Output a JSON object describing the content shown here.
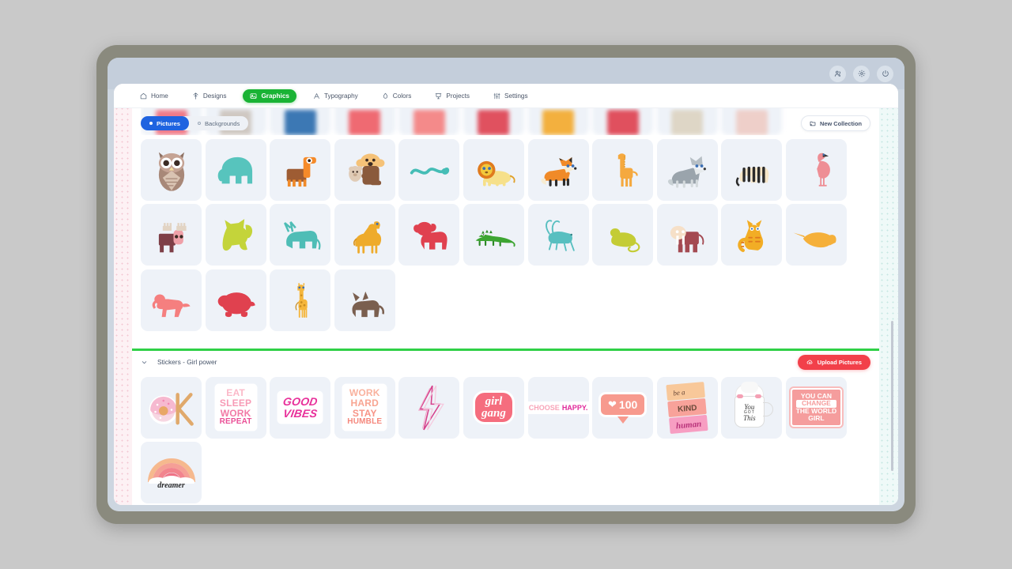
{
  "os_bar": {
    "icons": [
      {
        "name": "users-icon",
        "glyph": "users"
      },
      {
        "name": "gear-icon",
        "glyph": "gear"
      },
      {
        "name": "power-icon",
        "glyph": "power"
      }
    ]
  },
  "nav": {
    "items": [
      {
        "label": "Home",
        "icon": "home-icon",
        "active": false
      },
      {
        "label": "Designs",
        "icon": "designs-icon",
        "active": false
      },
      {
        "label": "Graphics",
        "icon": "graphics-icon",
        "active": true
      },
      {
        "label": "Typography",
        "icon": "typography-icon",
        "active": false
      },
      {
        "label": "Colors",
        "icon": "colors-icon",
        "active": false
      },
      {
        "label": "Projects",
        "icon": "projects-icon",
        "active": false
      },
      {
        "label": "Settings",
        "icon": "settings-icon",
        "active": false
      }
    ],
    "active_color": "#19b334"
  },
  "toolbar": {
    "toggles": [
      {
        "label": "Pictures",
        "selected": true
      },
      {
        "label": "Backgrounds",
        "selected": false
      }
    ],
    "new_collection_label": "New Collection",
    "selected_color": "#1f63e0"
  },
  "stickers_section": {
    "title": "Stickers - Girl power",
    "upload_label": "Upload Pictures",
    "upload_color": "#f2404a",
    "collapsed": false
  },
  "divider_color": "#2fd046",
  "pictures_grid": {
    "blurred_row": [
      {
        "name": "flamingo-blurred",
        "color": "#f07a88"
      },
      {
        "name": "goat-blurred",
        "color": "#cfc8c2"
      },
      {
        "name": "donkey-blurred",
        "color": "#3c78b4"
      },
      {
        "name": "horse-blurred",
        "color": "#ef6a72"
      },
      {
        "name": "dog-blurred",
        "color": "#f48a8a"
      },
      {
        "name": "pig-blurred",
        "color": "#e0515f"
      },
      {
        "name": "lion-blurred",
        "color": "#f3b03e"
      },
      {
        "name": "cow-blurred",
        "color": "#e0505e"
      },
      {
        "name": "sheep-blurred",
        "color": "#ded6c6"
      },
      {
        "name": "rabbit-blurred",
        "color": "#eecfc9"
      }
    ],
    "rows": [
      [
        {
          "name": "owl",
          "color": "#a88878"
        },
        {
          "name": "elephant",
          "color": "#57c4bd"
        },
        {
          "name": "deer",
          "color": "#f58a29"
        },
        {
          "name": "koala",
          "color": "#f5c278"
        },
        {
          "name": "snake",
          "color": "#45bdb6"
        },
        {
          "name": "lion",
          "color": "#f2c83c"
        },
        {
          "name": "fox",
          "color": "#f08a28"
        },
        {
          "name": "giraffe",
          "color": "#f5a93f"
        },
        {
          "name": "wolf",
          "color": "#9aa4ac"
        },
        {
          "name": "zebra",
          "color": "#f6e6c8"
        },
        {
          "name": "flamingo",
          "color": "#ee8e95"
        }
      ],
      [
        {
          "name": "moose",
          "color": "#8e4a52"
        },
        {
          "name": "cat-silhouette",
          "color": "#c4d43a"
        },
        {
          "name": "bull",
          "color": "#4ebdb6"
        },
        {
          "name": "camel",
          "color": "#eeab2c"
        },
        {
          "name": "ram",
          "color": "#e0414f"
        },
        {
          "name": "crocodile",
          "color": "#3da532"
        },
        {
          "name": "grasshopper",
          "color": "#58bfc0"
        },
        {
          "name": "mouse",
          "color": "#c4cc35"
        },
        {
          "name": "elephant-flat",
          "color": "#a44a52"
        },
        {
          "name": "tabby-cat",
          "color": "#f2ad25"
        },
        {
          "name": "narwhal",
          "color": "#f5b03a"
        }
      ],
      [
        {
          "name": "poodle",
          "color": "#f57f7f"
        },
        {
          "name": "turtle",
          "color": "#e0414f"
        },
        {
          "name": "giraffe-illustration",
          "color": "#f5b63c"
        },
        {
          "name": "dog-silhouette",
          "color": "#7a5f4f"
        }
      ]
    ]
  },
  "stickers_grid": {
    "rows": [
      [
        {
          "name": "donut-ok-sticker",
          "kind": "donut_ok"
        },
        {
          "name": "eat-sleep-work-repeat-sticker",
          "kind": "stack",
          "lines": [
            "EAT",
            "SLEEP",
            "WORK",
            "REPEAT"
          ],
          "colors": [
            "#fbb8c8",
            "#f79bb6",
            "#f27aa6",
            "#ea4f96"
          ]
        },
        {
          "name": "good-vibes-sticker",
          "kind": "goodvibes",
          "lines": [
            "GOOD",
            "VIBES"
          ],
          "color": "#e8309a"
        },
        {
          "name": "work-hard-stay-humble-sticker",
          "kind": "stack",
          "lines": [
            "WORK",
            "HARD",
            "STAY",
            "HUMBLE"
          ],
          "colors": [
            "#f9b29e",
            "#f8a592",
            "#f79487",
            "#f5877c"
          ]
        },
        {
          "name": "lightning-bolt-sticker",
          "kind": "bolt",
          "color": "#d6418c"
        },
        {
          "name": "girl-gang-sticker",
          "kind": "script",
          "lines": [
            "girl",
            "gang"
          ],
          "color": "#f56d7e"
        },
        {
          "name": "choose-happy-sticker",
          "kind": "choosehappy",
          "text_a": "CHOOSE",
          "text_b": "HAPPY.",
          "color_a": "#f8a4b8",
          "color_b": "#e0279a"
        },
        {
          "name": "heart-100-likes-sticker",
          "kind": "heart100",
          "count": "100",
          "color": "#f79a8e"
        },
        {
          "name": "be-a-kind-human-sticker",
          "kind": "kindhuman",
          "lines": [
            "be a",
            "KIND",
            "human"
          ],
          "band_colors": [
            "#f8c89a",
            "#f8a29a",
            "#f79ec2"
          ]
        },
        {
          "name": "you-got-this-mug-sticker",
          "kind": "mug",
          "lines": [
            "You",
            "GOT",
            "This"
          ]
        },
        {
          "name": "you-can-change-the-world-girl-sticker",
          "kind": "worldgirl",
          "lines": [
            "YOU CAN",
            "CHANGE",
            "THE WORLD",
            "GIRL"
          ],
          "color": "#f59d9d"
        }
      ],
      [
        {
          "name": "dreamer-rainbow-sticker",
          "kind": "rainbow",
          "label": "dreamer"
        }
      ]
    ]
  }
}
